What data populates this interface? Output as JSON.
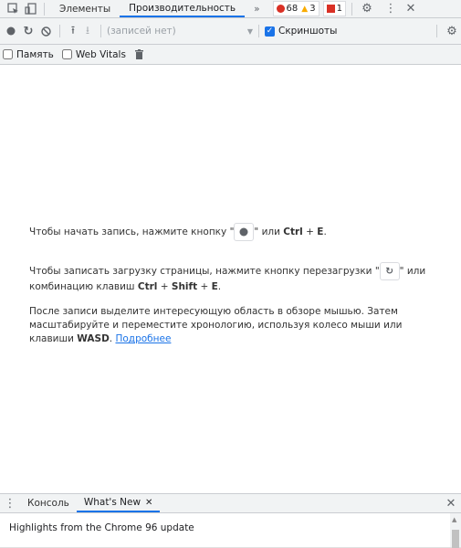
{
  "tabs": {
    "elements": "Элементы",
    "performance": "Производительность",
    "more": "»",
    "errors": "68",
    "warnings": "3",
    "issues": "1"
  },
  "toolbar": {
    "recordings_placeholder": "(записей нет)",
    "screenshots_label": "Скриншоты"
  },
  "options": {
    "memory_label": "Память",
    "web_vitals_label": "Web Vitals"
  },
  "messages": {
    "record_pre": "Чтобы начать запись, нажмите кнопку \"",
    "record_mid": "\" или ",
    "record_key": "Ctrl",
    "record_plus": " + ",
    "record_key2": "E",
    "record_end": ".",
    "reload_pre": "Чтобы записать загрузку страницы, нажмите кнопку перезагрузки \"",
    "reload_mid": "\" или комбинацию клавиш ",
    "reload_k1": "Ctrl",
    "reload_k2": "Shift",
    "reload_k3": "E",
    "after_pre": "После записи выделите интересующую область в обзоре мышью. Затем масштабируйте и переместите хронологию, используя колесо мыши или клавиши ",
    "after_key": "WASD",
    "after_dot": ". ",
    "after_link": "Подробнее"
  },
  "drawer": {
    "console_tab": "Консоль",
    "whatsnew_tab": "What's New",
    "highlights": "Highlights from the Chrome 96 update"
  },
  "colors": {
    "accent": "#1a73e8",
    "error": "#d93025",
    "warning": "#f9ab00"
  }
}
